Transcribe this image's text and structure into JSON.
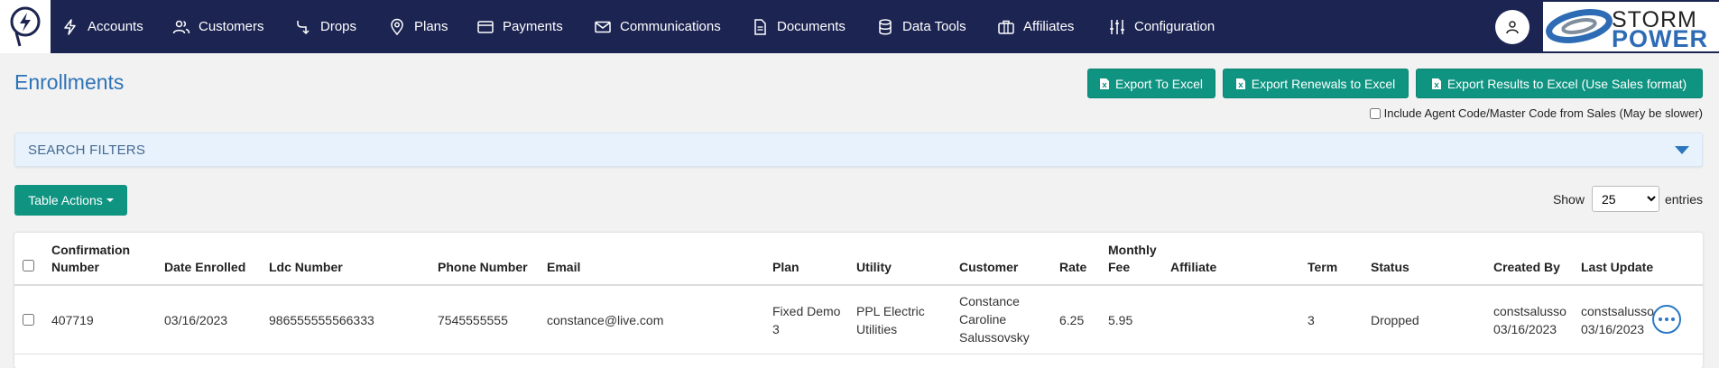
{
  "nav": {
    "items": [
      {
        "label": "Accounts",
        "icon": "lightning-icon"
      },
      {
        "label": "Customers",
        "icon": "users-icon"
      },
      {
        "label": "Drops",
        "icon": "arrow-turn-down-icon"
      },
      {
        "label": "Plans",
        "icon": "map-pin-icon"
      },
      {
        "label": "Payments",
        "icon": "credit-card-icon"
      },
      {
        "label": "Communications",
        "icon": "envelope-icon"
      },
      {
        "label": "Documents",
        "icon": "document-icon"
      },
      {
        "label": "Data Tools",
        "icon": "database-icon"
      },
      {
        "label": "Affiliates",
        "icon": "briefcase-icon"
      },
      {
        "label": "Configuration",
        "icon": "sliders-icon"
      }
    ],
    "brand_top": "STORM",
    "brand_bottom": "POWER",
    "colors": {
      "navbar": "#1c2452",
      "brand_blue": "#2d6cb5"
    }
  },
  "page": {
    "title": "Enrollments",
    "export_excel": "Export To Excel",
    "export_renewals": "Export Renewals to Excel",
    "export_results": "Export Results to Excel (Use Sales format)",
    "include_agent_code": "Include Agent Code/Master Code from Sales (May be slower)",
    "search_filters": "SEARCH FILTERS",
    "table_actions": "Table Actions",
    "show_label": "Show",
    "entries_label": "entries",
    "page_size": "25",
    "accent_color": "#0f9481"
  },
  "table": {
    "headers": {
      "confirmation": "Confirmation Number",
      "date_enrolled": "Date Enrolled",
      "ldc": "Ldc Number",
      "phone": "Phone Number",
      "email": "Email",
      "plan": "Plan",
      "utility": "Utility",
      "customer": "Customer",
      "rate": "Rate",
      "monthly_fee": "Monthly Fee",
      "affiliate": "Affiliate",
      "term": "Term",
      "status": "Status",
      "created_by": "Created By",
      "last_update": "Last Update"
    },
    "rows": [
      {
        "confirmation": "407719",
        "date_enrolled": "03/16/2023",
        "ldc": "986555555566333",
        "phone": "7545555555",
        "email": "constance@live.com",
        "plan": "Fixed Demo 3",
        "utility": "PPL Electric Utilities",
        "customer": "Constance Caroline Salussovsky",
        "rate": "6.25",
        "monthly_fee": "5.95",
        "affiliate": "",
        "term": "3",
        "status": "Dropped",
        "created_by_user": "constsalusso",
        "created_by_date": "03/16/2023",
        "last_update_user": "constsalusso",
        "last_update_date": "03/16/2023"
      }
    ]
  }
}
